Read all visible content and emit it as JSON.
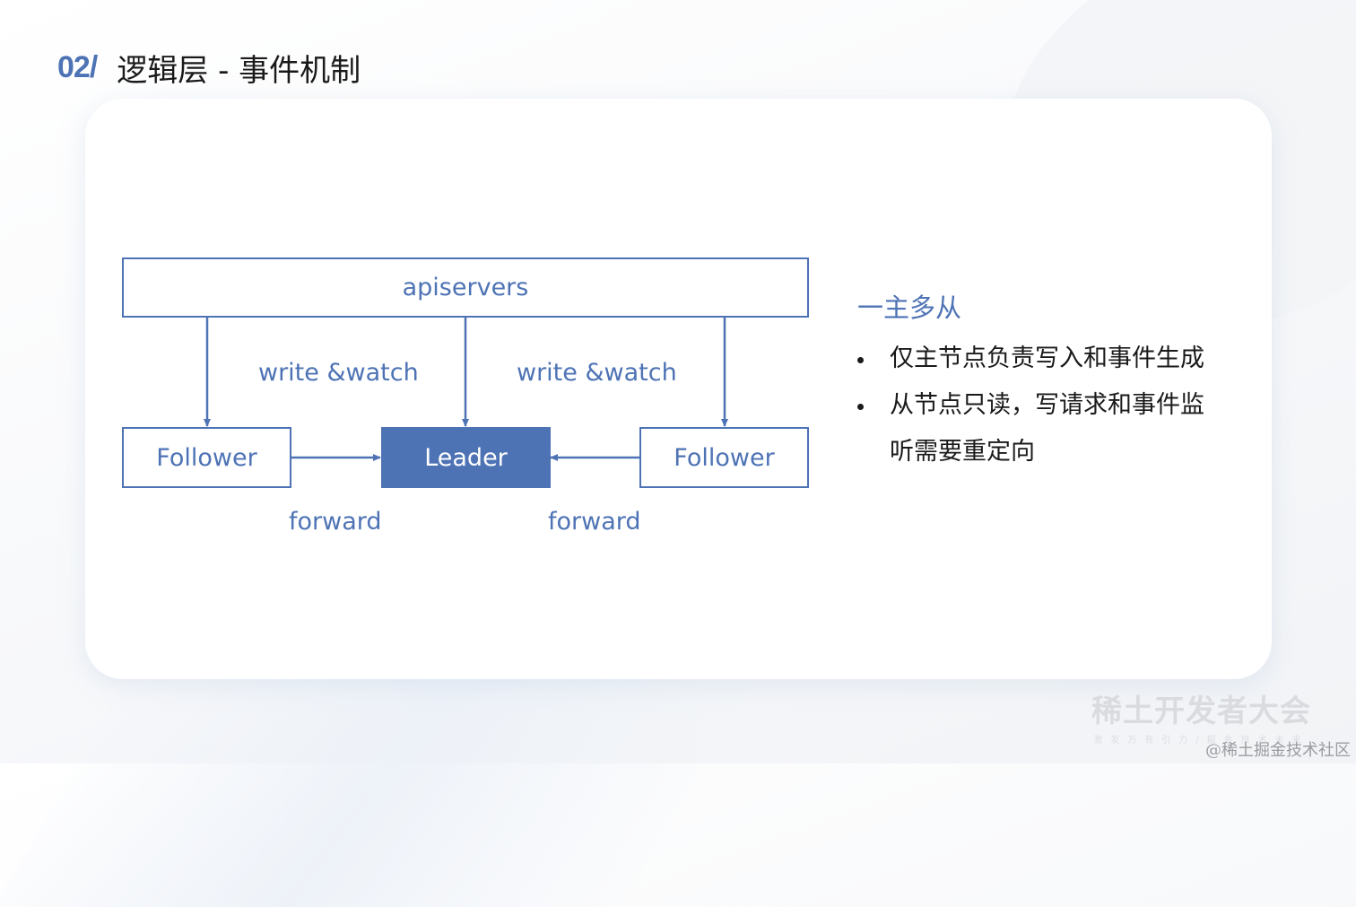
{
  "slide": {
    "number": "02/",
    "title": "逻辑层 - 事件机制"
  },
  "colors": {
    "accent": "#4E73B5",
    "text": "#1A1A1A",
    "card": "#FFFFFF"
  },
  "diagram": {
    "apiservers": "apiservers",
    "follower_left": "Follower",
    "leader": "Leader",
    "follower_right": "Follower",
    "edge_write_watch_left": "write &watch",
    "edge_write_watch_right": "write &watch",
    "edge_forward_left": "forward",
    "edge_forward_right": "forward"
  },
  "side_panel": {
    "heading": "一主多从",
    "bullets": [
      "仅主节点负责写入和事件生成",
      "从节点只读，写请求和事件监听需要重定向"
    ]
  },
  "watermark": {
    "brand": "稀土开发者大会",
    "slogan": "激发万有引力/掘金技术未来",
    "credit": "@稀土掘金技术社区"
  }
}
